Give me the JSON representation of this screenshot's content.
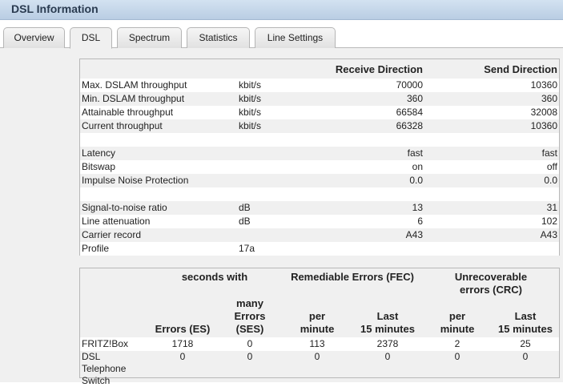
{
  "header": {
    "title": "DSL Information"
  },
  "tabs": [
    {
      "label": "Overview",
      "active": false
    },
    {
      "label": "DSL",
      "active": true
    },
    {
      "label": "Spectrum",
      "active": false
    },
    {
      "label": "Statistics",
      "active": false
    },
    {
      "label": "Line Settings",
      "active": false
    }
  ],
  "dsl_table": {
    "headers": {
      "receive": "Receive Direction",
      "send": "Send Direction"
    },
    "rows": [
      {
        "label": "Max. DSLAM throughput",
        "unit": "kbit/s",
        "receive": "70000",
        "send": "10360"
      },
      {
        "label": "Min. DSLAM throughput",
        "unit": "kbit/s",
        "receive": "360",
        "send": "360"
      },
      {
        "label": "Attainable throughput",
        "unit": "kbit/s",
        "receive": "66584",
        "send": "32008"
      },
      {
        "label": "Current throughput",
        "unit": "kbit/s",
        "receive": "66328",
        "send": "10360"
      },
      {
        "label": "Latency",
        "unit": "",
        "receive": "fast",
        "send": "fast"
      },
      {
        "label": "Bitswap",
        "unit": "",
        "receive": "on",
        "send": "off"
      },
      {
        "label": "Impulse Noise Protection",
        "unit": "",
        "receive": "0.0",
        "send": "0.0"
      },
      {
        "label": "Signal-to-noise ratio",
        "unit": "dB",
        "receive": "13",
        "send": "31"
      },
      {
        "label": "Line attenuation",
        "unit": "dB",
        "receive": "6",
        "send": "102"
      },
      {
        "label": "Carrier record",
        "unit": "",
        "receive": "A43",
        "send": "A43"
      },
      {
        "label": "Profile",
        "unit": "17a",
        "receive": "",
        "send": ""
      }
    ]
  },
  "error_table": {
    "group_headers": {
      "seconds_with": "seconds with",
      "fec": "Remediable Errors (FEC)",
      "crc": "Unrecoverable errors (CRC)"
    },
    "sub_headers": {
      "es": "Errors (ES)",
      "ses_line1": "many",
      "ses_line2": "Errors (SES)",
      "fec_per_line1": "per",
      "fec_per_line2": "minute",
      "fec_last_line1": "Last",
      "fec_last_line2": "15 minutes",
      "crc_per_line1": "per",
      "crc_per_line2": "minute",
      "crc_last_line1": "Last",
      "crc_last_line2": "15 minutes"
    },
    "rows": [
      {
        "label": "FRITZ!Box",
        "es": "1718",
        "ses": "0",
        "fec_per_min": "113",
        "fec_last15": "2378",
        "crc_per_min": "2",
        "crc_last15": "25"
      },
      {
        "label_line1": "DSL",
        "label_line2": "Telephone",
        "label_line3": "Switch",
        "es": "0",
        "ses": "0",
        "fec_per_min": "0",
        "fec_last15": "0",
        "crc_per_min": "0",
        "crc_last15": "0"
      }
    ]
  }
}
